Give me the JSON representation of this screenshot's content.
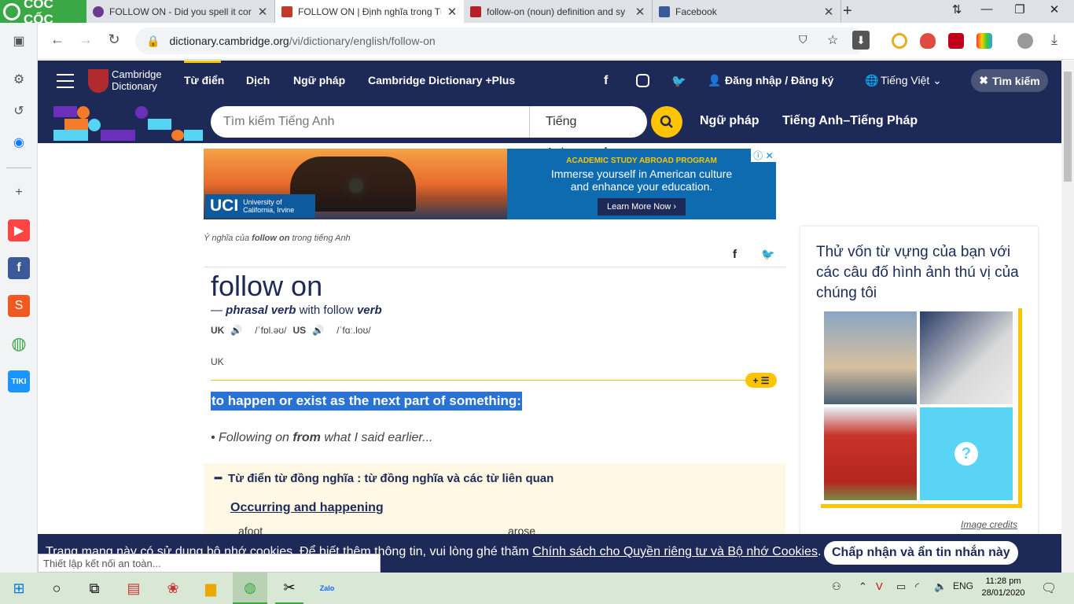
{
  "browser": {
    "brand": "CỐC CỐC",
    "tabs": [
      {
        "title": "FOLLOW ON - Did you spell it corr",
        "color": "#6c3a8e"
      },
      {
        "title": "FOLLOW ON | Định nghĩa trong Từ",
        "color": "#c0392b"
      },
      {
        "title": "follow-on (noun) definition and sy",
        "color": "#b3202a"
      },
      {
        "title": "Facebook",
        "color": "#3b5998"
      }
    ],
    "url_host": "dictionary.cambridge.org",
    "url_path": "/vi/dictionary/english/follow-on",
    "status_text": "Thiết lập kết nối an toàn..."
  },
  "cambridge": {
    "logo_line1": "Cambridge",
    "logo_line2": "Dictionary",
    "nav": [
      "Từ điển",
      "Dịch",
      "Ngữ pháp",
      "Cambridge Dictionary +Plus"
    ],
    "login": "Đăng nhập / Đăng ký",
    "language": "Tiếng Việt",
    "search_toggle": "Tìm kiếm",
    "search_placeholder": "Tìm kiếm Tiếng Anh",
    "search_lang": "Tiếng Anh",
    "link_grammar": "Ngữ pháp",
    "link_en_fr": "Tiếng Anh–Tiếng Pháp"
  },
  "ad": {
    "tag": "ACADEMIC STUDY ABROAD PROGRAM",
    "line1": "Immerse yourself in American culture",
    "line2": "and enhance your education.",
    "cta": "Learn More Now",
    "brand": "UCI",
    "brand_sub1": "University of",
    "brand_sub2": "California, Irvine"
  },
  "entry": {
    "crumb_pre": "Ý nghĩa của ",
    "crumb_word": "follow on",
    "crumb_post": " trong tiếng Anh",
    "headword": "follow on",
    "pos": "phrasal verb",
    "with_text": "with follow",
    "with_pos": "verb",
    "uk_label": "UK",
    "uk_ipa": "/ˈfɒl.əʊ/",
    "us_label": "US",
    "us_ipa": "/ˈfɑː.loʊ/",
    "region": "UK",
    "definition": "to happen or exist as the next part of something:",
    "example_pre": "Following on ",
    "example_bold": "from",
    "example_post": " what I said earlier...",
    "thesaurus_head": "Từ điển từ đồng nghĩa : từ đồng nghĩa và các từ liên quan",
    "thesaurus_sub": "Occurring and happening",
    "word1": "afoot",
    "word2": "arose"
  },
  "quiz": {
    "title": "Thử vốn từ vựng của bạn với các câu đố hình ảnh thú vị của chúng tôi",
    "credits": "Image credits"
  },
  "cookie": {
    "text_pre": "Trang mạng này có sử dụng bộ nhớ cookies. Để biết thêm thông tin, vui lòng ghé thăm ",
    "link": "Chính sách cho Quyền riêng tư và Bộ nhớ Cookies",
    "text_post": ".",
    "button": "Chấp nhận và ẩn tin nhắn này"
  },
  "taskbar": {
    "lang": "ENG",
    "time": "11:28 pm",
    "date": "28/01/2020"
  }
}
